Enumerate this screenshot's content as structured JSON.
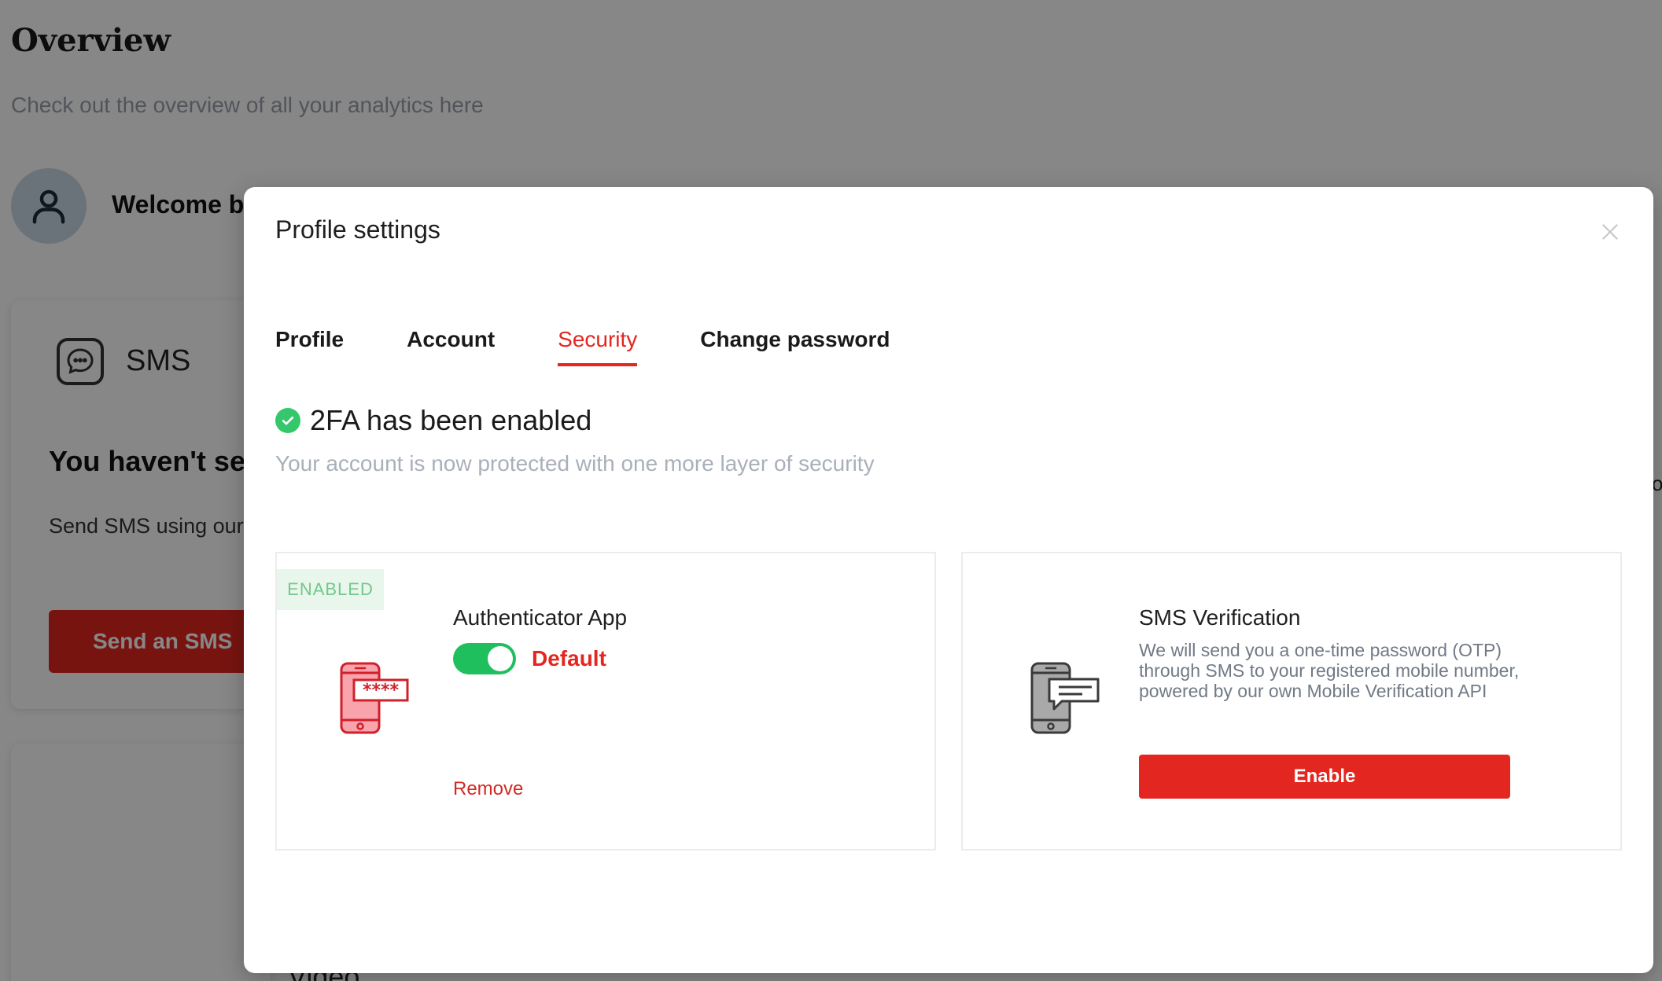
{
  "background": {
    "page_title": "Overview",
    "page_subtitle": "Check out the overview of all your analytics here",
    "welcome_text": "Welcome ba",
    "sms_card": {
      "title": "SMS",
      "heading": "You haven't ser",
      "text": "Send SMS using our",
      "button_label": "Send an SMS"
    },
    "video_label": "Video",
    "right_edge_glyph": "o"
  },
  "modal": {
    "title": "Profile settings",
    "tabs": [
      {
        "label": "Profile",
        "active": false
      },
      {
        "label": "Account",
        "active": false
      },
      {
        "label": "Security",
        "active": true
      },
      {
        "label": "Change password",
        "active": false
      }
    ],
    "status": {
      "title": "2FA has been enabled",
      "subtitle": "Your account is now protected with one more layer of security"
    },
    "authenticator": {
      "badge": "ENABLED",
      "name": "Authenticator App",
      "toggle_on": true,
      "default_label": "Default",
      "remove_label": "Remove"
    },
    "sms_verification": {
      "name": "SMS Verification",
      "description": "We will send you a one-time password (OTP) through SMS to your registered mobile number, powered by our own Mobile Verification API",
      "button_label": "Enable"
    }
  },
  "colors": {
    "accent": "#e3261f",
    "success": "#34c76b",
    "toggle": "#1fbf5d",
    "badge_bg": "#e9f6ec",
    "badge_text": "#74c78d"
  }
}
